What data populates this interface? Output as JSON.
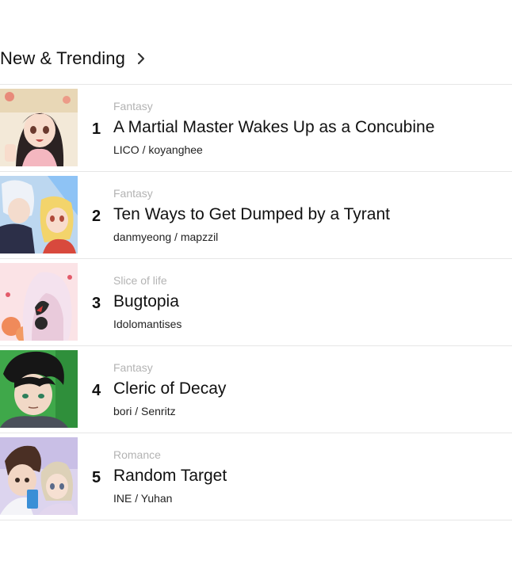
{
  "section": {
    "title": "New & Trending",
    "chevron_icon": "chevron-right-icon"
  },
  "items": [
    {
      "rank": "1",
      "genre": "Fantasy",
      "title": "A Martial Master Wakes Up as a Concubine",
      "author": "LICO / koyanghee"
    },
    {
      "rank": "2",
      "genre": "Fantasy",
      "title": "Ten Ways to Get Dumped by a Tyrant",
      "author": "danmyeong / mapzzil"
    },
    {
      "rank": "3",
      "genre": "Slice of life",
      "title": "Bugtopia",
      "author": "Idolomantises"
    },
    {
      "rank": "4",
      "genre": "Fantasy",
      "title": "Cleric of Decay",
      "author": "bori / Senritz"
    },
    {
      "rank": "5",
      "genre": "Romance",
      "title": "Random Target",
      "author": "INE / Yuhan"
    }
  ]
}
